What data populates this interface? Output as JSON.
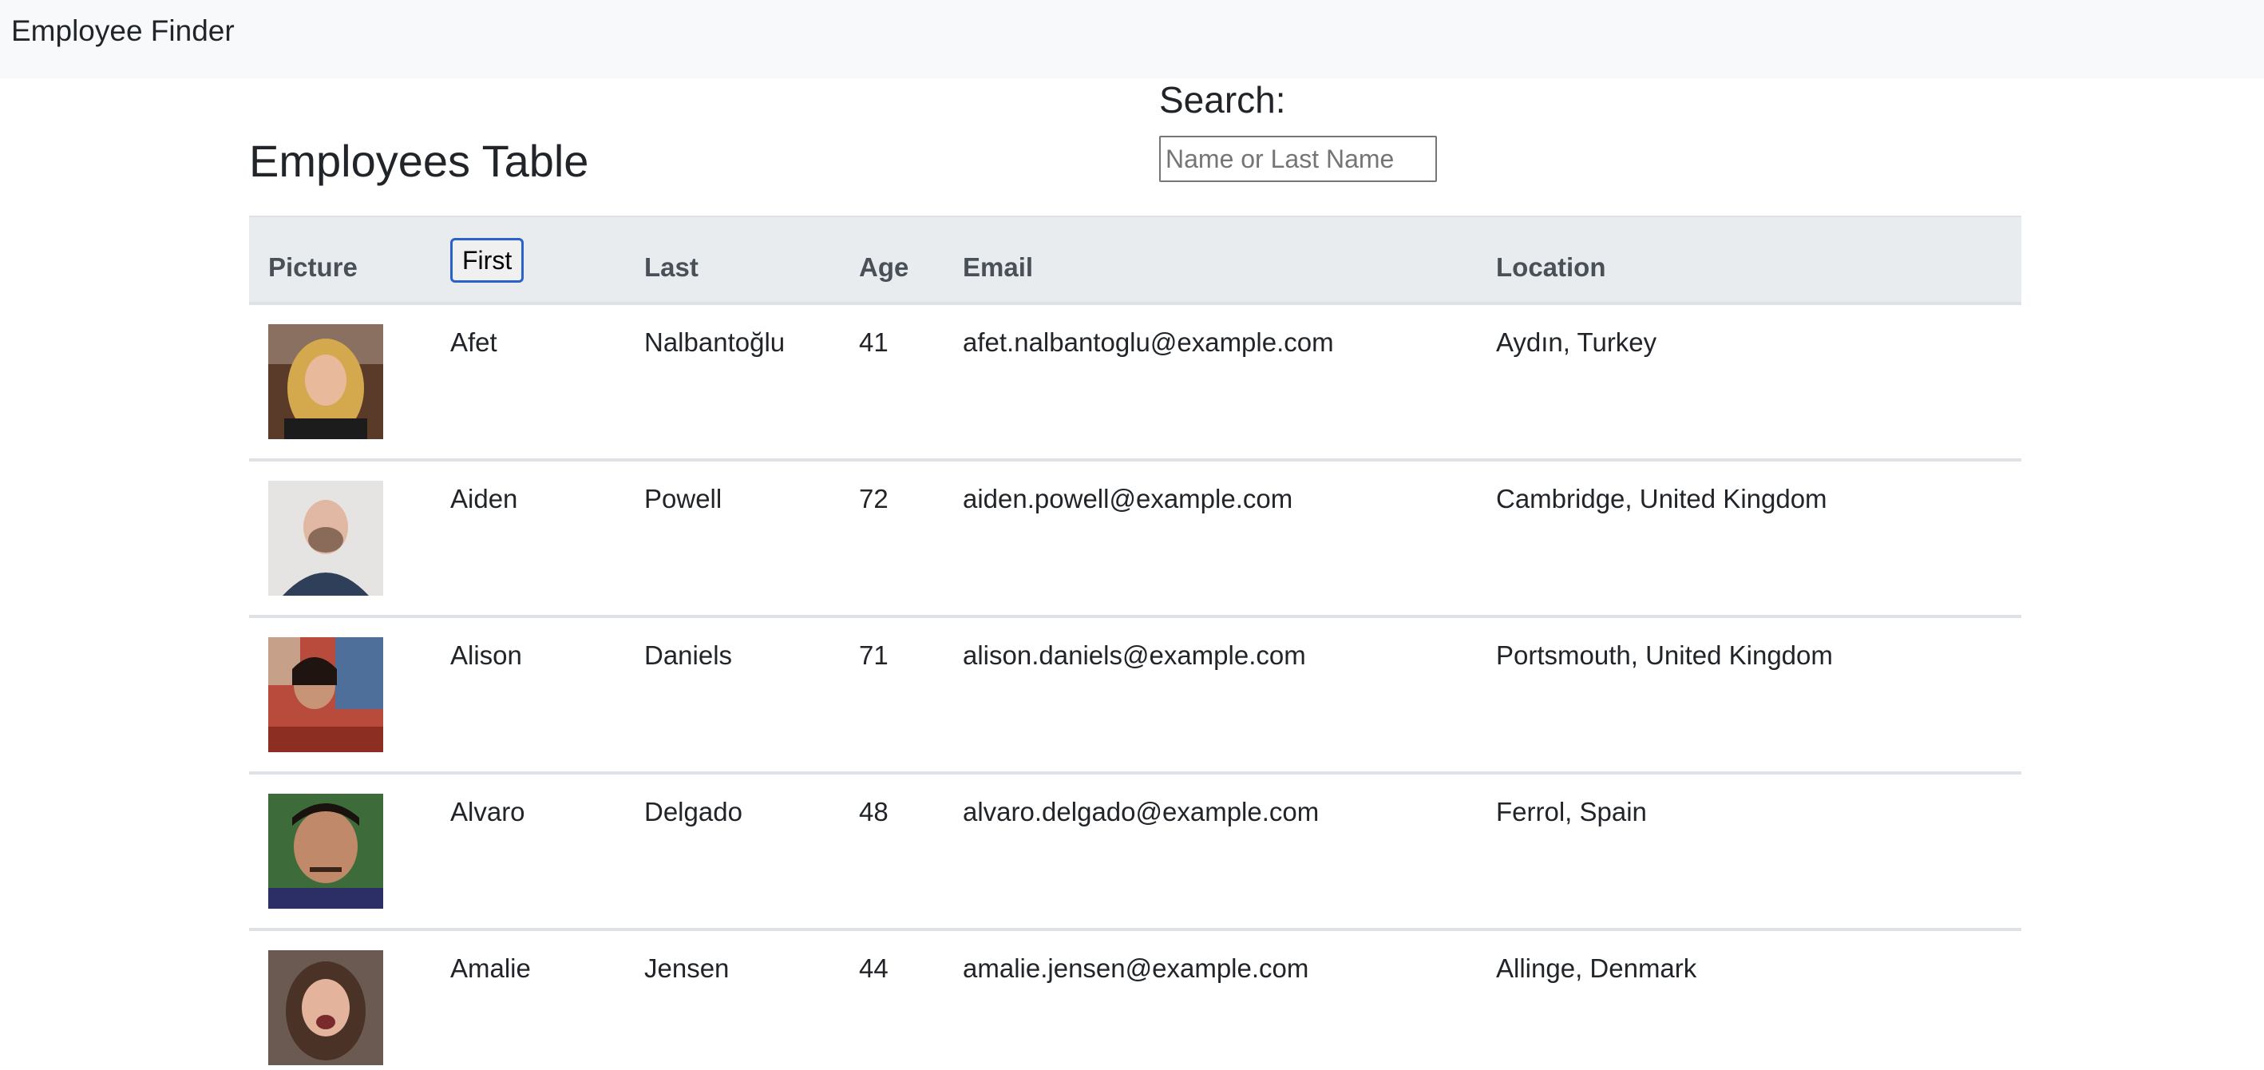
{
  "navbar": {
    "brand": "Employee Finder"
  },
  "main": {
    "title": "Employees Table",
    "search": {
      "label": "Search:",
      "placeholder": "Name or Last Name",
      "value": ""
    }
  },
  "table": {
    "columns": {
      "picture": "Picture",
      "first": "First",
      "last": "Last",
      "age": "Age",
      "email": "Email",
      "location": "Location"
    },
    "rows": [
      {
        "first": "Afet",
        "last": "Nalbantoğlu",
        "age": "41",
        "email": "afet.nalbantoglu@example.com",
        "location": "Aydın, Turkey"
      },
      {
        "first": "Aiden",
        "last": "Powell",
        "age": "72",
        "email": "aiden.powell@example.com",
        "location": "Cambridge, United Kingdom"
      },
      {
        "first": "Alison",
        "last": "Daniels",
        "age": "71",
        "email": "alison.daniels@example.com",
        "location": "Portsmouth, United Kingdom"
      },
      {
        "first": "Alvaro",
        "last": "Delgado",
        "age": "48",
        "email": "alvaro.delgado@example.com",
        "location": "Ferrol, Spain"
      },
      {
        "first": "Amalie",
        "last": "Jensen",
        "age": "44",
        "email": "amalie.jensen@example.com",
        "location": "Allinge, Denmark"
      }
    ]
  },
  "colors": {
    "navbar_bg": "#f8f9fa",
    "header_bg": "#e9ecef",
    "focus_ring": "#2a62c9"
  }
}
